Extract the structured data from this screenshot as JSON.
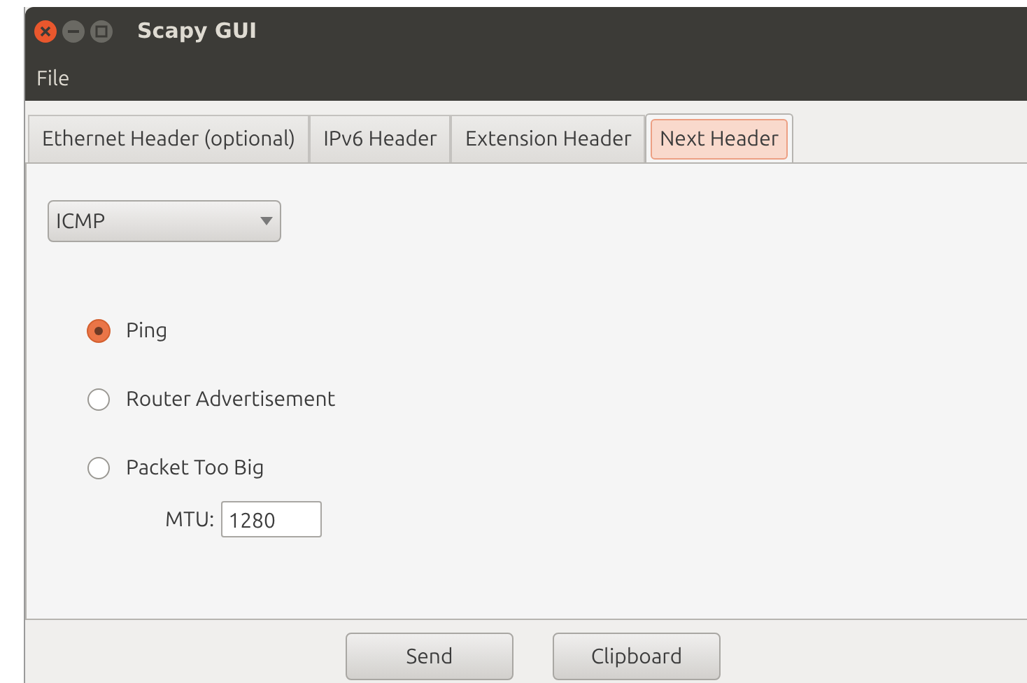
{
  "window": {
    "title": "Scapy GUI"
  },
  "menu": [
    "File"
  ],
  "tabs": [
    {
      "label": "Ethernet Header (optional)",
      "selected": false
    },
    {
      "label": "IPv6 Header",
      "selected": false
    },
    {
      "label": "Extension Header",
      "selected": false
    },
    {
      "label": "Next Header",
      "selected": true
    }
  ],
  "protocol_dropdown": {
    "value": "ICMP"
  },
  "options": [
    {
      "label": "Ping",
      "selected": true
    },
    {
      "label": "Router Advertisement",
      "selected": false
    },
    {
      "label": "Packet Too Big",
      "selected": false
    }
  ],
  "mtu": {
    "label": "MTU:",
    "value": "1280"
  },
  "buttons": [
    "Send",
    "Clipboard"
  ]
}
